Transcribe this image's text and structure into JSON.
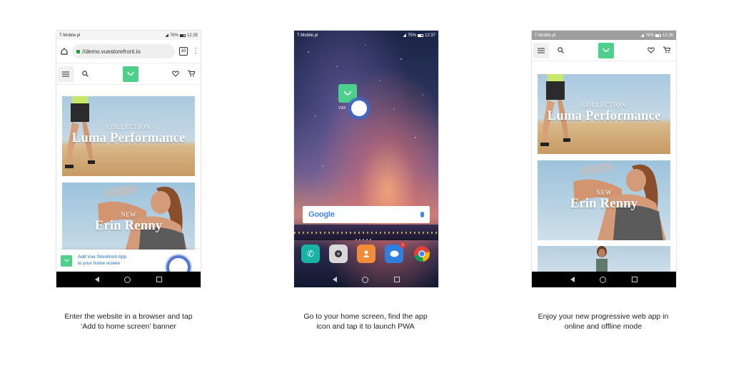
{
  "phone1": {
    "status": {
      "carrier": "T-Mobile.pl",
      "battery": "76%",
      "time": "12:35"
    },
    "browser": {
      "url": "//demo.vuestorefront.io",
      "tabs_count": "10"
    },
    "banner1": {
      "subtitle": "COLLECTION",
      "title": "Luma Performance"
    },
    "banner2": {
      "subtitle": "NEW",
      "title": "Erin Renny"
    },
    "install": {
      "line1": "Add Vue Storefront App",
      "line2": "to your home screen"
    }
  },
  "phone2": {
    "status": {
      "carrier": "T-Mobile.pl",
      "battery": "75%",
      "time": "12:37"
    },
    "app_label": "VSF",
    "search": {
      "brand": "Google"
    },
    "dock_badge": "1"
  },
  "phone3": {
    "status": {
      "carrier": "T-Mobile.pl",
      "battery": "76%",
      "time": "12:36"
    },
    "banner1": {
      "subtitle": "COLLECTION",
      "title": "Luma Performance"
    },
    "banner2": {
      "subtitle": "NEW",
      "title": "Erin Renny"
    }
  },
  "captions": [
    {
      "line1": "Enter the website in a browser and tap",
      "line2": "‘Add to home screen’ banner"
    },
    {
      "line1": "Go to your home screen, find the app",
      "line2": "icon and tap it to launch PWA"
    },
    {
      "line1": "Enjoy your new progressive web app in",
      "line2": "online and offline mode"
    }
  ],
  "colors": {
    "brand_green": "#4fd08a",
    "touch_blue": "#3d68c8",
    "link_blue": "#1565c0"
  }
}
